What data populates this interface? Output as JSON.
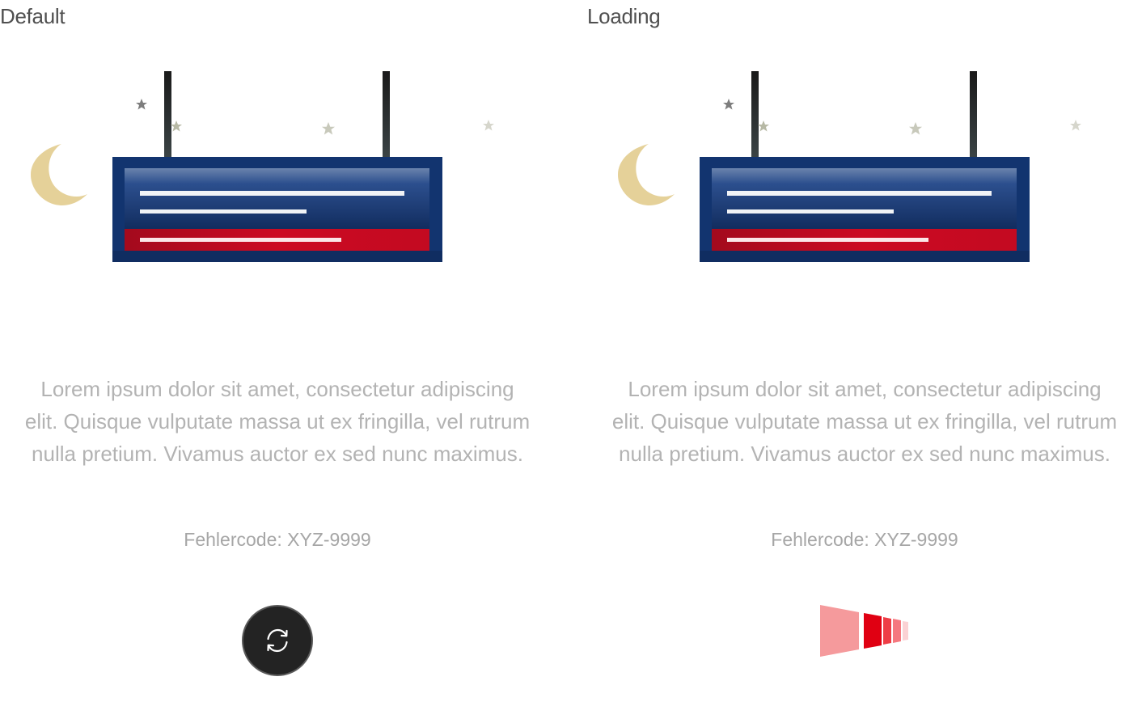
{
  "variants": [
    {
      "label": "Default",
      "message": "Lorem ipsum dolor sit amet, consectetur adipiscing elit. Quisque vulputate massa ut ex fringilla, vel rutrum nulla pretium. Vivamus auctor ex sed nunc maximus.",
      "error_code": "Fehlercode: XYZ-9999",
      "action": {
        "type": "reload-button",
        "icon": "refresh-icon"
      }
    },
    {
      "label": "Loading",
      "message": "Lorem ipsum dolor sit amet, consectetur adipiscing elit. Quisque vulputate massa ut ex fringilla, vel rutrum nulla pretium. Vivamus auctor ex sed nunc maximus.",
      "error_code": "Fehlercode: XYZ-9999",
      "action": {
        "type": "loading-indicator",
        "icon": "loading-spinner-icon"
      }
    }
  ],
  "illustration": {
    "icons": [
      "moon-icon",
      "star-icon",
      "departure-board-icon"
    ]
  },
  "colors": {
    "board_blue": "#173d7a",
    "board_red": "#c80a22",
    "moon": "#e7d49d",
    "button_bg": "#232323",
    "loader_red": "#e00012",
    "loader_light": "#f59a9c",
    "text_light": "#b3b3b3"
  }
}
